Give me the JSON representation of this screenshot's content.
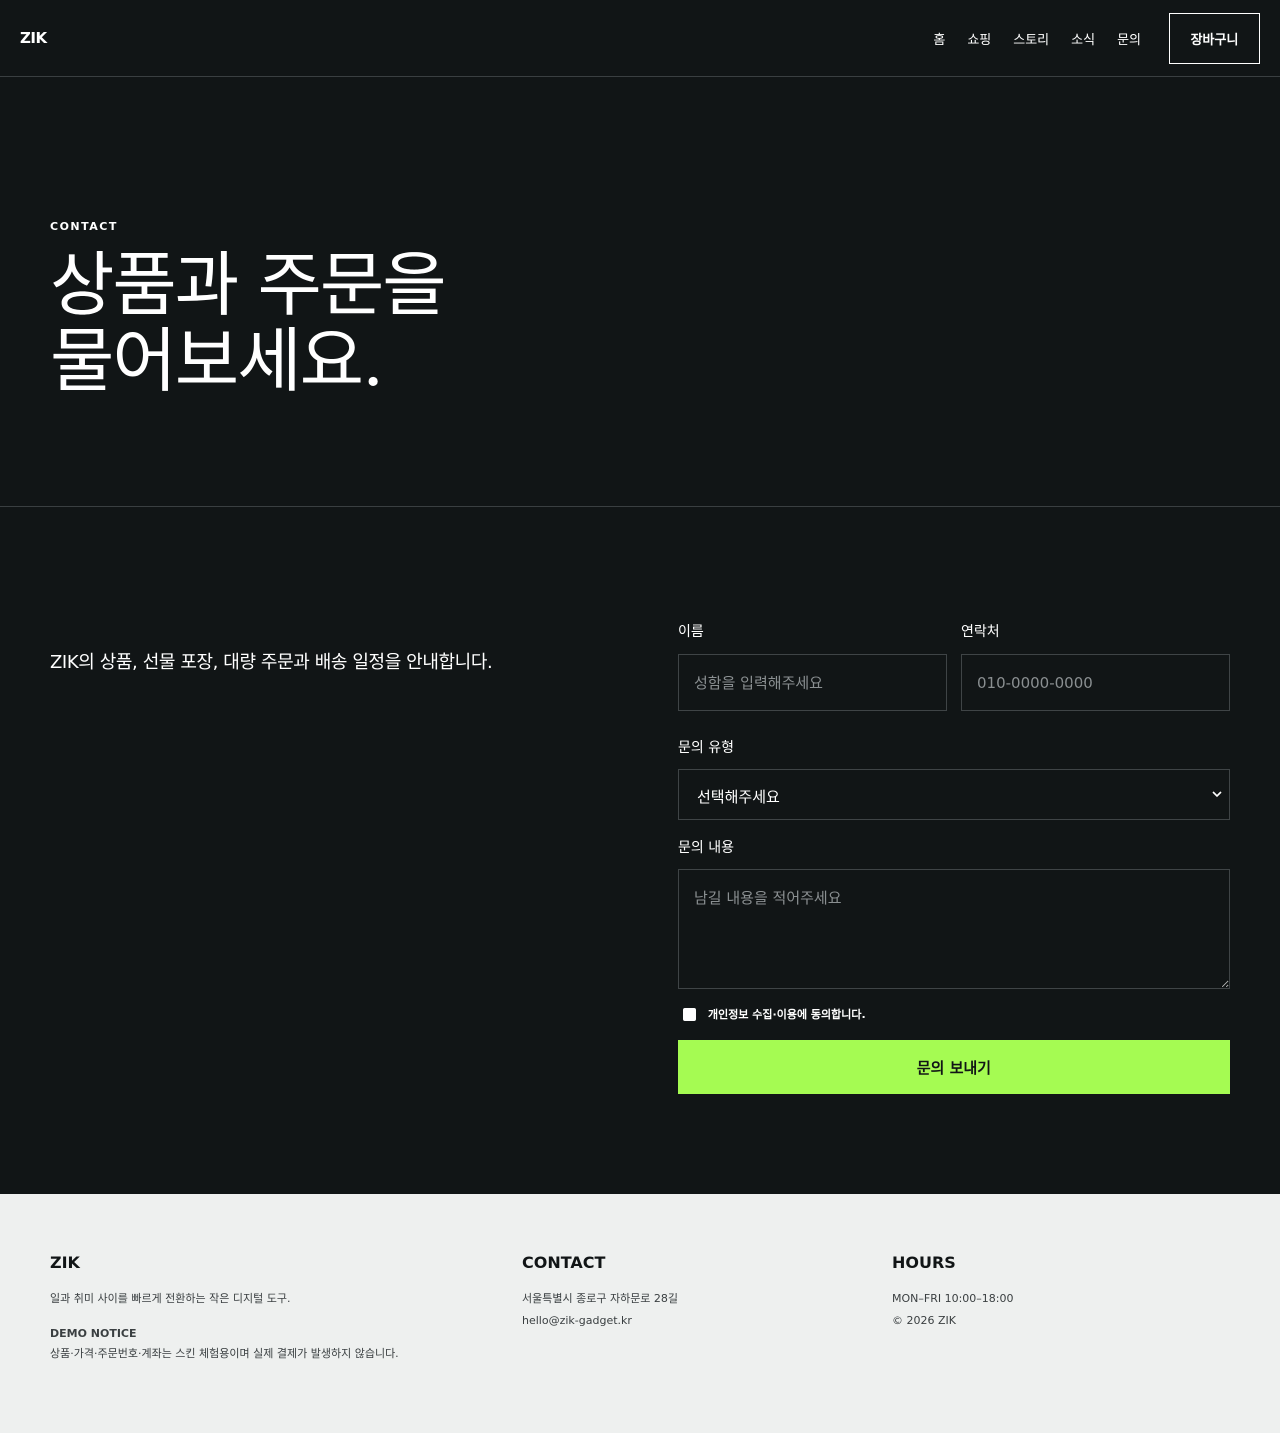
{
  "header": {
    "logo": "ZIK",
    "nav": [
      "홈",
      "쇼핑",
      "스토리",
      "소식",
      "문의"
    ],
    "cart_label": "장바구니"
  },
  "hero": {
    "eyebrow": "CONTACT",
    "title_line1": "상품과 주문을",
    "title_line2": "물어보세요."
  },
  "contact": {
    "intro": "ZIK의 상품, 선물 포장, 대량 주문과 배송 일정을 안내합니다.",
    "name_label": "이름",
    "name_placeholder": "성함을 입력해주세요",
    "phone_label": "연락처",
    "phone_placeholder": "010-0000-0000",
    "type_label": "문의 유형",
    "type_selected": "선택해주세요",
    "message_label": "문의 내용",
    "message_placeholder": "남길 내용을 적어주세요",
    "consent_label": "개인정보 수집·이용에 동의합니다.",
    "submit_label": "문의 보내기",
    "accent_color": "#a5fb52"
  },
  "footer": {
    "brand": {
      "heading": "ZIK",
      "tagline": "일과 취미 사이를 빠르게 전환하는 작은 디지털 도구.",
      "notice_heading": "DEMO NOTICE",
      "notice_text": "상품·가격·주문번호·계좌는 스킨 체험용이며 실제 결제가 발생하지 않습니다."
    },
    "contact": {
      "heading": "CONTACT",
      "address": "서울특별시 종로구 자하문로 28길",
      "email": "hello@zik-gadget.kr"
    },
    "hours": {
      "heading": "HOURS",
      "time": "MON–FRI 10:00–18:00",
      "copyright": "© 2026 ZIK"
    }
  }
}
